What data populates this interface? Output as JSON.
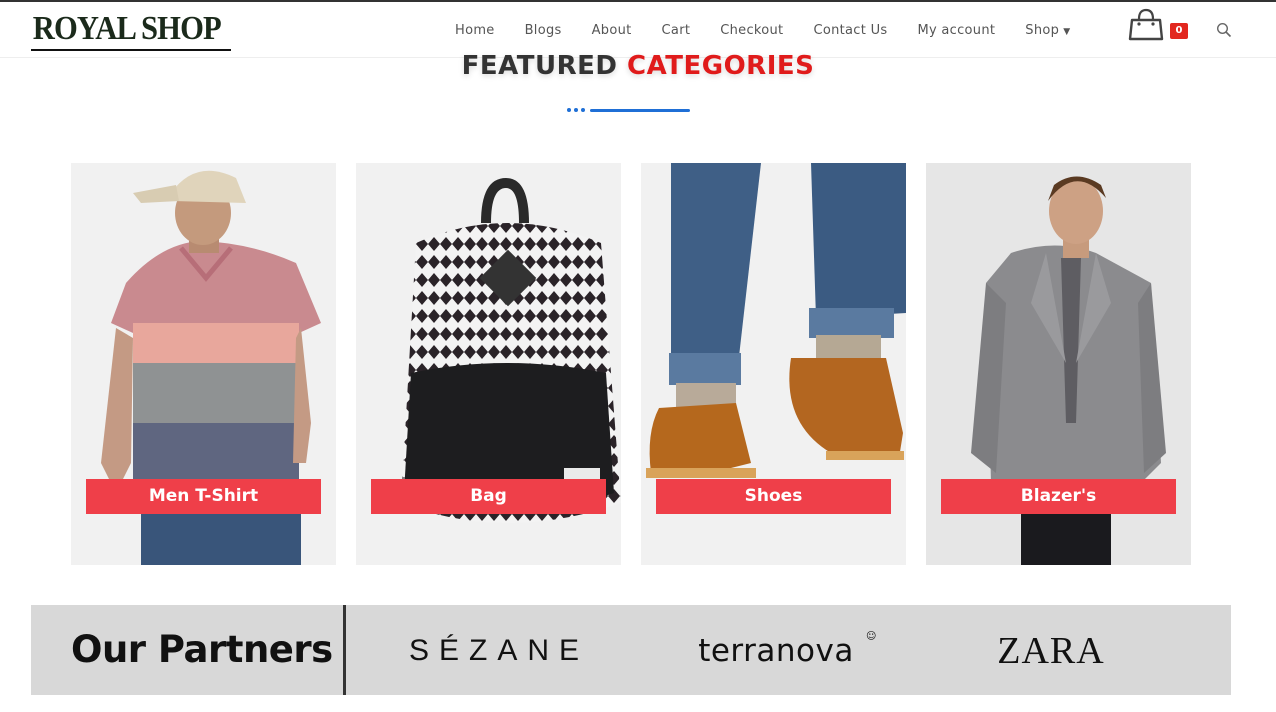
{
  "header": {
    "logo_text": "ROYAL SHOP",
    "nav": [
      {
        "label": "Home"
      },
      {
        "label": "Blogs"
      },
      {
        "label": "About"
      },
      {
        "label": "Cart"
      },
      {
        "label": "Checkout"
      },
      {
        "label": "Contact Us"
      },
      {
        "label": "My account"
      },
      {
        "label": "Shop",
        "has_dropdown": true
      }
    ],
    "cart_count": "0",
    "icons": {
      "cart": "shopping-bag-icon",
      "search": "search-icon",
      "dropdown": "chevron-down-icon"
    }
  },
  "featured": {
    "title_part1": "FEATURED",
    "title_part2": "CATEGORIES",
    "categories": [
      {
        "label": "Men T-Shirt",
        "image": "man in striped polo shirt and cap"
      },
      {
        "label": "Bag",
        "image": "black and white patterned backpack"
      },
      {
        "label": "Shoes",
        "image": "brown suede desert boots with jeans"
      },
      {
        "label": "Blazer's",
        "image": "man in grey blazer"
      }
    ]
  },
  "partners": {
    "title": "Our Partners",
    "brands": [
      "SÉZANE",
      "terranova",
      "ZARA"
    ]
  },
  "colors": {
    "accent_red": "#e01b1b",
    "label_red": "#ef3f49",
    "divider_blue": "#1f6fd6",
    "partners_bg": "#d8d8d8"
  }
}
